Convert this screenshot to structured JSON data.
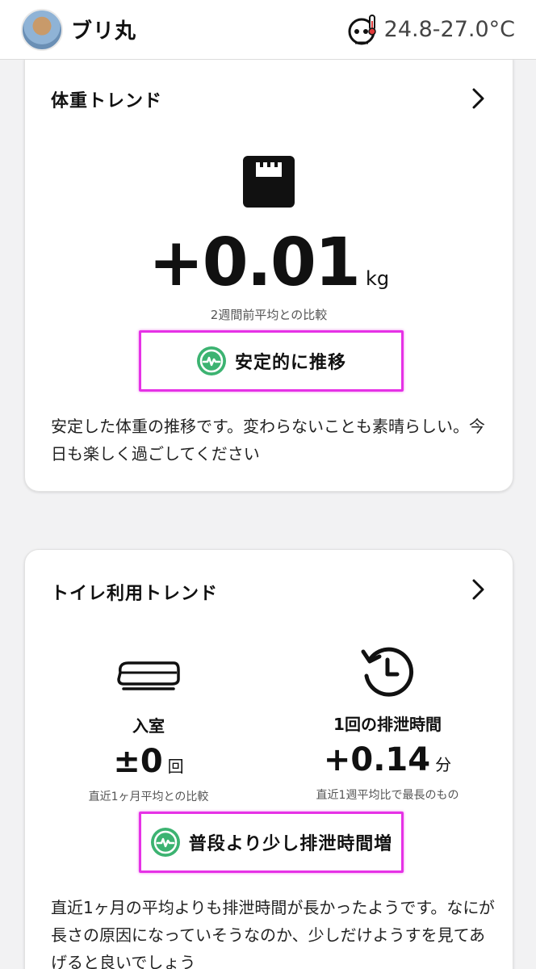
{
  "header": {
    "pet_name": "ブリ丸",
    "temperature": "24.8-27.0°C"
  },
  "weight_card": {
    "title": "体重トレンド",
    "value": "+0.01",
    "unit": "kg",
    "caption": "2週間前平均との比較",
    "status": "安定的に推移",
    "description": "安定した体重の推移です。変わらないことも素晴らしい。今日も楽しく過ごしてください"
  },
  "toilet_card": {
    "title": "トイレ利用トレンド",
    "entry": {
      "label": "入室",
      "value": "±0",
      "unit": "回",
      "caption": "直近1ヶ月平均との比較"
    },
    "duration": {
      "label": "1回の排泄時間",
      "value": "+0.14",
      "unit": "分",
      "caption": "直近1週平均比で最長のもの"
    },
    "status": "普段より少し排泄時間増",
    "description": "直近1ヶ月の平均よりも排泄時間が長かったようです。なにが長さの原因になっていそうなのか、少しだけようすを見てあげると良いでしょう"
  },
  "colors": {
    "status_green": "#3cb371",
    "highlight_magenta": "#e632e6"
  }
}
